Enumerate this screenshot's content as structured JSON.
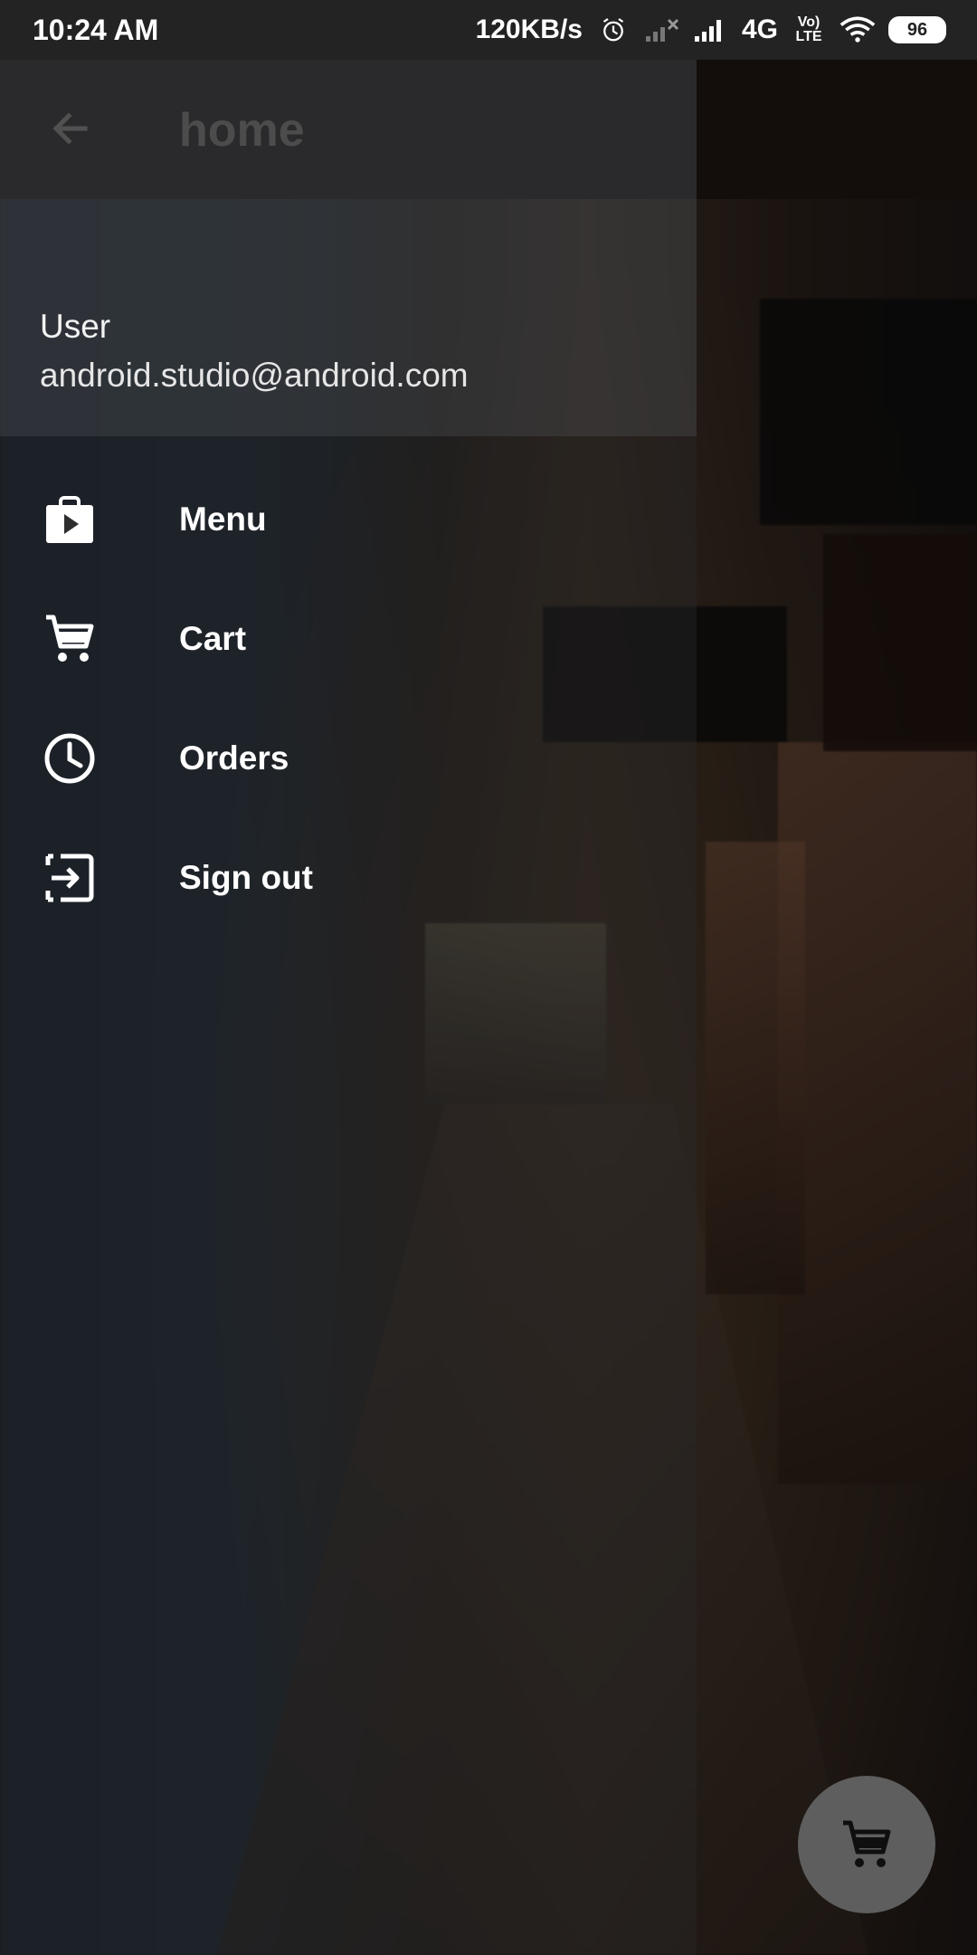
{
  "status_bar": {
    "time": "10:24 AM",
    "net_speed": "120KB/s",
    "network_type": "4G",
    "volte": "Vo) LTE",
    "battery": "96",
    "icons": [
      "alarm-icon",
      "signal-no-service-icon",
      "signal-icon",
      "wifi-icon",
      "battery-icon"
    ]
  },
  "app_bar": {
    "title": "home",
    "back_icon": "arrow-back-icon"
  },
  "drawer": {
    "header": {
      "name": "User",
      "email": "android.studio@android.com"
    },
    "items": [
      {
        "label": "Menu",
        "icon": "shop-bag-icon"
      },
      {
        "label": "Cart",
        "icon": "cart-icon"
      },
      {
        "label": "Orders",
        "icon": "clock-icon"
      },
      {
        "label": "Sign out",
        "icon": "exit-icon"
      }
    ]
  },
  "fab": {
    "icon": "cart-icon"
  },
  "colors": {
    "drawer_text": "#ffffff",
    "fab_bg": "#5e5e5e",
    "status_bar_bg": "#232323"
  }
}
